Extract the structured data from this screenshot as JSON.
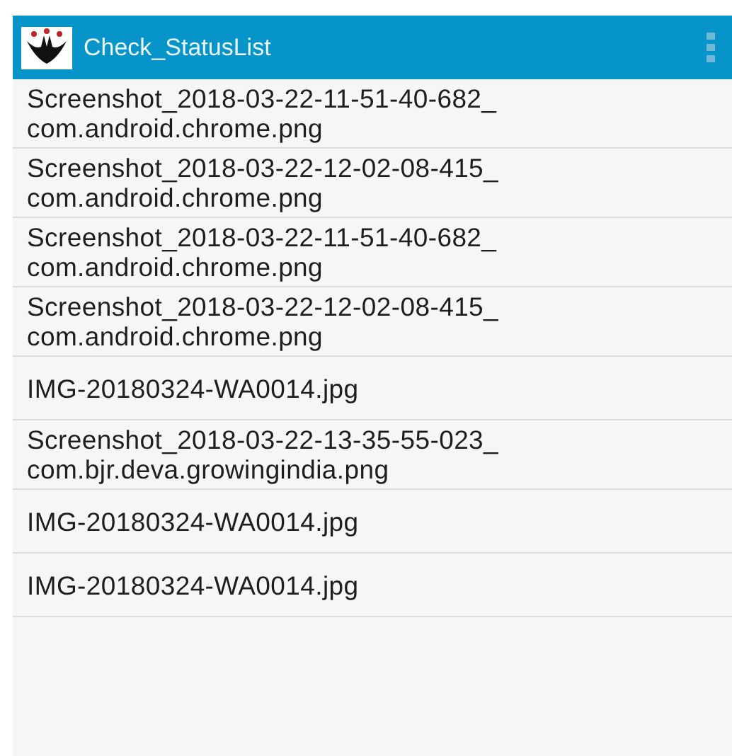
{
  "app_bar": {
    "title": "Check_StatusList"
  },
  "files": [
    {
      "lines": [
        "Screenshot_2018-03-22-11-51-40-682_",
        "com.android.chrome.png"
      ]
    },
    {
      "lines": [
        "Screenshot_2018-03-22-12-02-08-415_",
        "com.android.chrome.png"
      ]
    },
    {
      "lines": [
        "Screenshot_2018-03-22-11-51-40-682_",
        "com.android.chrome.png"
      ]
    },
    {
      "lines": [
        "Screenshot_2018-03-22-12-02-08-415_",
        "com.android.chrome.png"
      ]
    },
    {
      "lines": [
        "IMG-20180324-WA0014.jpg"
      ]
    },
    {
      "lines": [
        "Screenshot_2018-03-22-13-35-55-023_",
        "com.bjr.deva.growingindia.png"
      ]
    },
    {
      "lines": [
        "IMG-20180324-WA0014.jpg"
      ]
    },
    {
      "lines": [
        "IMG-20180324-WA0014.jpg"
      ]
    }
  ]
}
